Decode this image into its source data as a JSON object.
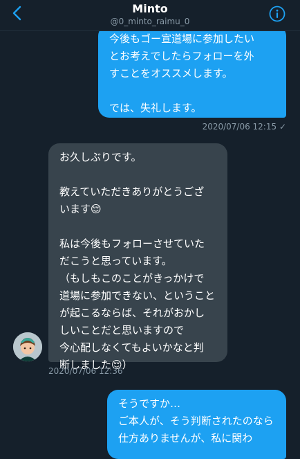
{
  "header": {
    "title": "Minto",
    "handle": "@0_minto_raimu_0"
  },
  "messages": [
    {
      "direction": "sent",
      "text": "今後もゴー宣道場に参加したい\nとお考えでしたらフォローを外\nすことをオススメします。\n\nでは、失礼します。",
      "timestamp": "2020/07/06 12:15 ✓"
    },
    {
      "direction": "received",
      "text": "お久しぶりです。\n\n教えていただきありがとうござ\nいます😌\n\n私は今後もフォローさせていた\nだこうと思っています。\n（もしもこのことがきっかけで\n道場に参加できない、ということ\nが起こるならば、それがおかし\nしいことだと思いますので\n今心配しなくてもよいかなと判\n断しました😌）",
      "timestamp": "2020/07/06 12:36"
    },
    {
      "direction": "sent",
      "text": "そうですか…\nご本人が、そう判断されたのなら仕方ありませんが、私に関わ"
    }
  ]
}
